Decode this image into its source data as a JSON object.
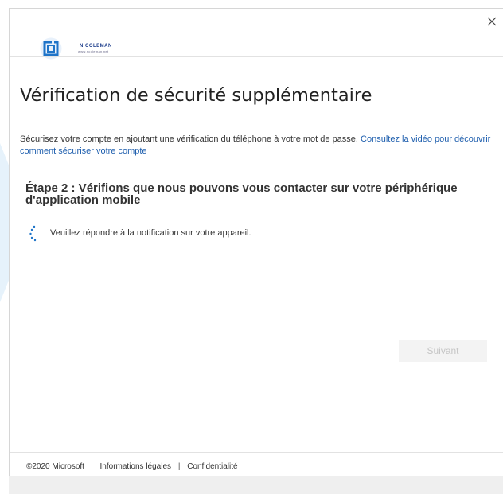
{
  "window": {
    "close_glyph": "×"
  },
  "logo": {
    "name": "N COLEMAN",
    "tagline": "www.ncoleman.net",
    "icon": "brand-logo-icon",
    "accent": "#1e74c8"
  },
  "main": {
    "title": "Vérification de sécurité supplémentaire",
    "intro_text": "Sécurisez votre compte en ajoutant une vérification du téléphone à votre mot de passe. ",
    "intro_link": "Consultez la vidéo pour découvrir comment sécuriser votre compte",
    "step_heading": "Étape 2 : Vérifions que nous pouvons vous contacter sur votre périphérique d'application mobile",
    "notify_text": "Veuillez répondre à la notification sur votre appareil.",
    "spinner_icon": "loading-spinner-icon",
    "next_button": "Suivant"
  },
  "footer": {
    "copyright": "©2020 Microsoft",
    "legal": "Informations légales",
    "separator": "|",
    "privacy": "Confidentialité"
  },
  "colors": {
    "link": "#1f5fae",
    "text": "#333333",
    "title": "#222222",
    "button_disabled_bg": "#f3f3f3",
    "button_disabled_text": "#c6c6c6"
  }
}
